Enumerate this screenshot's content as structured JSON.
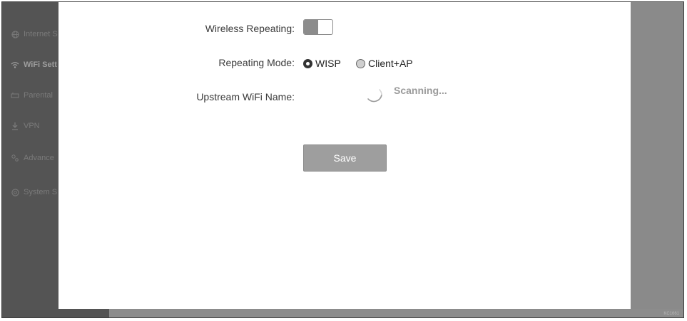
{
  "sidebar": {
    "items": [
      {
        "label": "Internet S",
        "icon": "globe-icon",
        "active": false
      },
      {
        "label": "WiFi Sett",
        "icon": "wifi-icon",
        "active": true
      },
      {
        "label": "Parental",
        "icon": "parental-icon",
        "active": false
      },
      {
        "label": "VPN",
        "icon": "vpn-icon",
        "active": false
      },
      {
        "label": "Advance",
        "icon": "advanced-icon",
        "active": false
      },
      {
        "label": "System S",
        "icon": "system-icon",
        "active": false
      }
    ]
  },
  "form": {
    "wireless_repeating_label": "Wireless Repeating:",
    "wireless_repeating_enabled": true,
    "repeating_mode_label": "Repeating Mode:",
    "repeating_mode_options": [
      {
        "label": "WISP",
        "checked": true
      },
      {
        "label": "Client+AP",
        "checked": false
      }
    ],
    "upstream_wifi_label": "Upstream WiFi Name:",
    "scanning_text": "Scanning...",
    "save_label": "Save"
  },
  "watermark": "KC1661"
}
